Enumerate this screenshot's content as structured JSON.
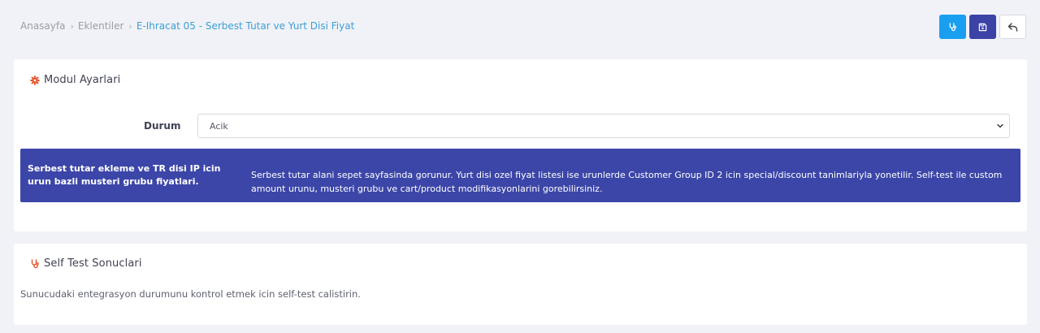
{
  "breadcrumb": {
    "items": [
      "Anasayfa",
      "Eklentiler"
    ],
    "separator": "›",
    "current": "E-Ihracat 05 - Serbest Tutar ve Yurt Disi Fiyat"
  },
  "toolbar": {
    "test_icon": "stethoscope-icon",
    "save_icon": "save-icon",
    "back_icon": "reply-icon"
  },
  "modul_card": {
    "title": "Modul Ayarlari",
    "title_icon": "gear-icon",
    "field_label": "Durum",
    "select_value": "Acik",
    "info_left": "Serbest tutar ekleme ve TR disi IP icin urun bazli musteri grubu fiyatlari.",
    "info_right": "Serbest tutar alani sepet sayfasinda gorunur. Yurt disi ozel fiyat listesi ise urunlerde Customer Group ID 2 icin special/discount tanimlariyla yonetilir. Self-test ile custom amount urunu, musteri grubu ve cart/product modifikasyonlarini gorebilirsiniz."
  },
  "self_test_card": {
    "title": "Self Test Sonuclari",
    "title_icon": "stethoscope-icon",
    "description": "Sunucudaki entegrasyon durumunu kontrol etmek icin self-test calistirin."
  },
  "colors": {
    "accent_blue": "#1a9ff0",
    "primary_indigo": "#3c43a6",
    "banner": "#3c46a8",
    "gear_orange": "#e8542c"
  }
}
